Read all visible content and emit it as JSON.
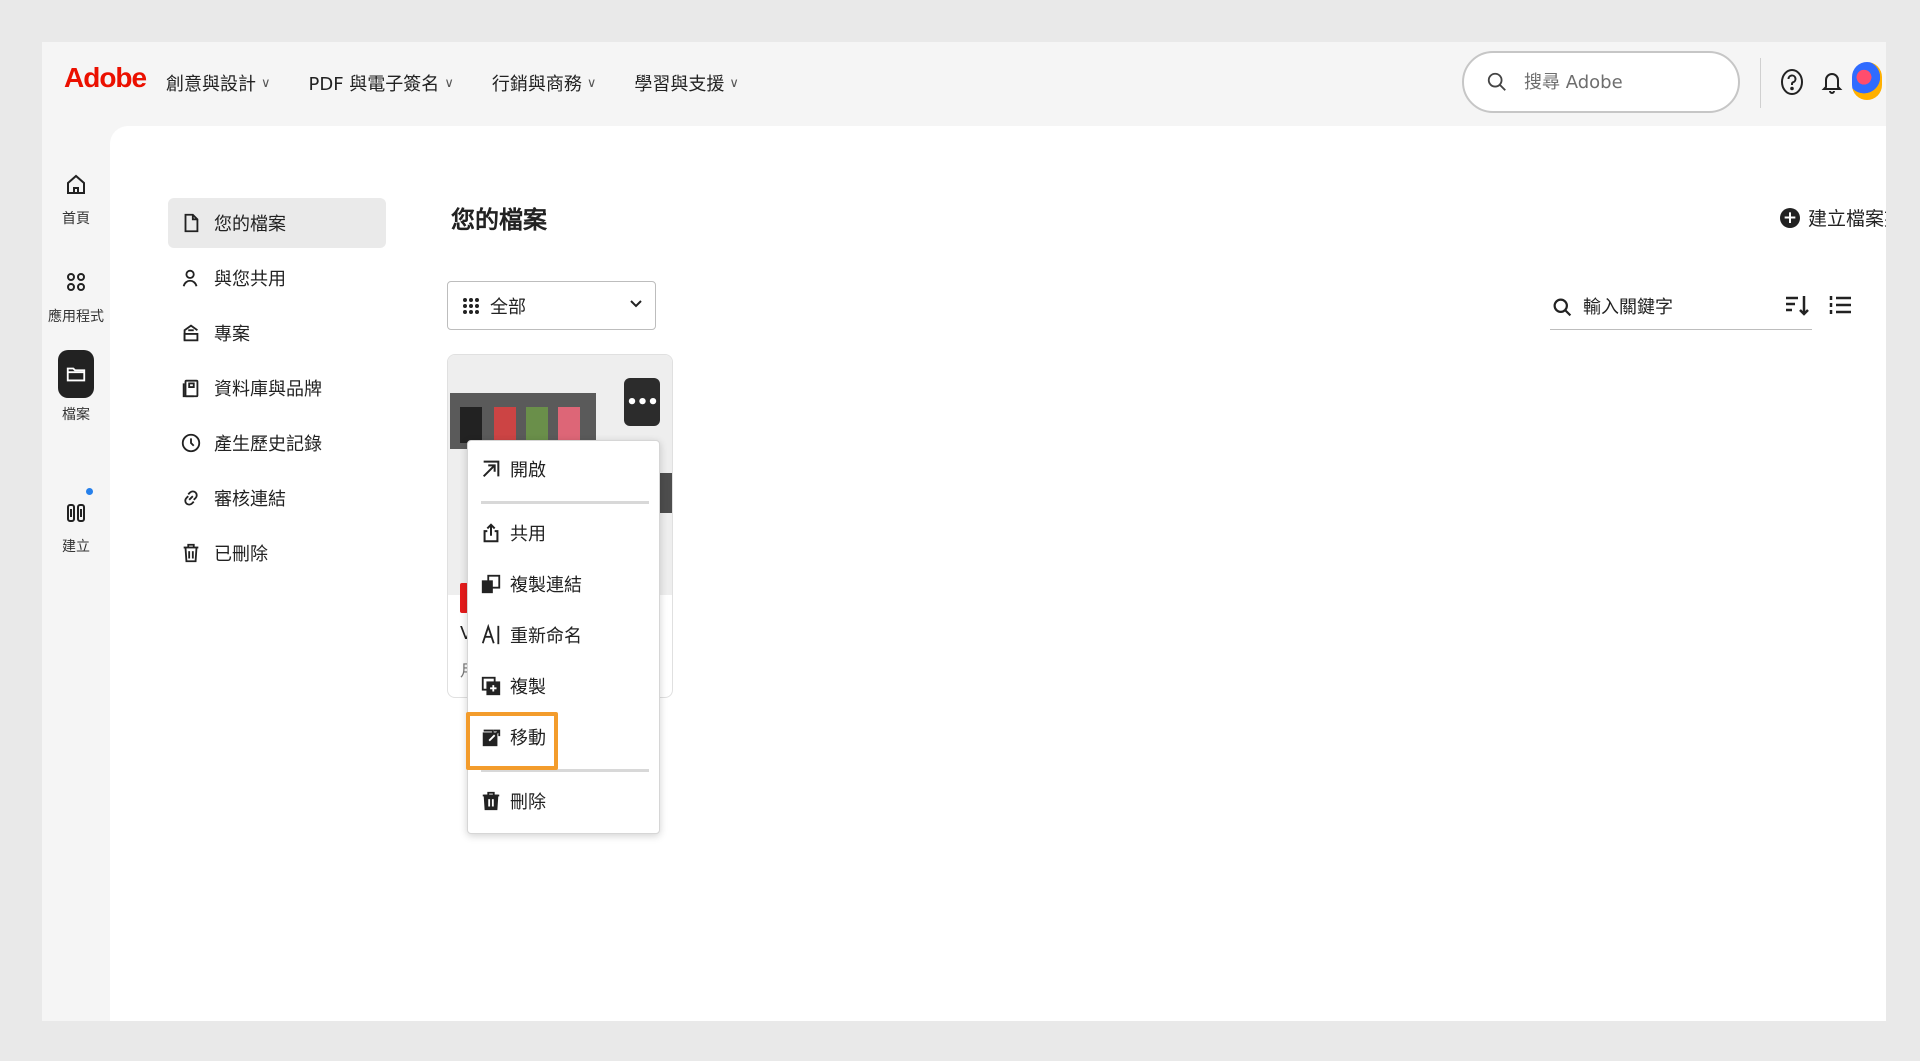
{
  "topbar": {
    "logo": "Adobe",
    "nav": [
      "創意與設計",
      "PDF 與電子簽名",
      "行銷與商務",
      "學習與支援"
    ],
    "nav_chevron": "∨",
    "search_placeholder": "搜尋 Adobe",
    "icons": [
      "help-icon",
      "bell-icon",
      "avatar"
    ]
  },
  "rail": {
    "items": [
      {
        "label": "首頁",
        "icon": "home-icon"
      },
      {
        "label": "應用程式",
        "icon": "apps-icon"
      },
      {
        "label": "檔案",
        "icon": "folder-icon"
      },
      {
        "label": "建立",
        "icon": "create-icon"
      }
    ],
    "active": "檔案"
  },
  "sidenav": {
    "items": [
      {
        "label": "您的檔案",
        "icon": "file-icon"
      },
      {
        "label": "與您共用",
        "icon": "shared-user-icon"
      },
      {
        "label": "專案",
        "icon": "project-icon"
      },
      {
        "label": "資料庫與品牌",
        "icon": "library-icon"
      },
      {
        "label": "產生歷史記錄",
        "icon": "history-icon"
      },
      {
        "label": "審核連結",
        "icon": "link-icon"
      },
      {
        "label": "已刪除",
        "icon": "trash-icon"
      }
    ],
    "active": "您的檔案"
  },
  "main": {
    "title": "您的檔案",
    "create_folder_label": "建立檔案夾",
    "filter_label": "全部",
    "keyword_placeholder": "輸入關鍵字",
    "card": {
      "name_visible": "V",
      "meta_visible": "月"
    }
  },
  "context_menu": {
    "items": [
      {
        "label": "開啟",
        "icon": "open-icon"
      },
      {
        "label": "共用",
        "icon": "share-icon"
      },
      {
        "label": "複製連結",
        "icon": "copy-link-icon"
      },
      {
        "label": "重新命名",
        "icon": "rename-icon"
      },
      {
        "label": "複製",
        "icon": "duplicate-icon"
      },
      {
        "label": "移動",
        "icon": "move-icon"
      },
      {
        "label": "刪除",
        "icon": "delete-icon"
      }
    ],
    "highlighted": "移動"
  },
  "colors": {
    "brand": "#eb1000",
    "highlight": "#f39c2c",
    "notification_dot": "#2680eb",
    "active_rail": "#222222"
  }
}
